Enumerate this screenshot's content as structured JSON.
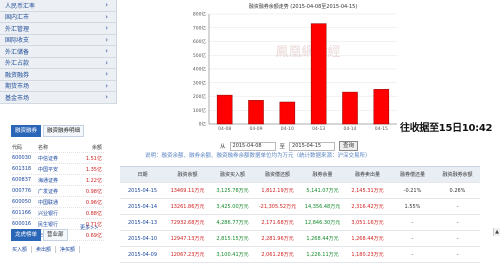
{
  "sidebar": {
    "items": [
      {
        "label": "人民币汇率",
        "icon": "chevron-right-icon"
      },
      {
        "label": "国内汇市",
        "icon": "chevron-right-icon"
      },
      {
        "label": "外汇管理",
        "icon": "chevron-right-icon"
      },
      {
        "label": "国际收支",
        "icon": "chevron-right-icon"
      },
      {
        "label": "外汇储备",
        "icon": "chevron-right-icon"
      },
      {
        "label": "外汇占款",
        "icon": "chevron-right-icon"
      },
      {
        "label": "融资融券",
        "icon": "chevron-right-icon"
      },
      {
        "label": "期货市场",
        "icon": "chevron-right-icon"
      },
      {
        "label": "基金市场",
        "icon": "chevron-right-icon"
      }
    ]
  },
  "rank_tabs": [
    {
      "label": "融资融券",
      "active": true
    },
    {
      "label": "融资融券明细",
      "active": false
    }
  ],
  "rank_list": {
    "header": [
      "代码",
      "名称",
      "余额"
    ],
    "rows": [
      [
        "600030",
        "中信证券",
        "1.51亿"
      ],
      [
        "601318",
        "中国平安",
        "1.35亿"
      ],
      [
        "600837",
        "海通证券",
        "1.22亿"
      ],
      [
        "000776",
        "广发证券",
        "0.98亿"
      ],
      [
        "600050",
        "中国联通",
        "0.96亿"
      ],
      [
        "601166",
        "兴业银行",
        "0.88亿"
      ],
      [
        "600016",
        "民生银行",
        "0.71亿"
      ],
      [
        "601688",
        "华泰证券",
        "0.69亿"
      ]
    ],
    "more": "更多>>"
  },
  "bottom_tabs": [
    {
      "label": "龙虎榜单",
      "active": true
    },
    {
      "label": "营业部",
      "active": false
    }
  ],
  "bottom_subtabs": [
    "买入额",
    "卖出额",
    "净买额"
  ],
  "chart_data": {
    "type": "bar",
    "title": "融资融券余额走势 (2015-04-08至2015-04-15)",
    "categories": [
      "04-08",
      "04-09",
      "04-10",
      "04-13",
      "04-14",
      "04-15"
    ],
    "values": [
      210,
      172,
      160,
      730,
      232,
      252
    ],
    "ylim": [
      0,
      800
    ],
    "yticks": [
      0,
      100,
      200,
      300,
      400,
      500,
      600,
      700,
      800
    ],
    "ytick_unit": "亿",
    "watermark": "鳳凰網財經",
    "color": "#ff0000",
    "grid": true
  },
  "overlay_text": "往收据至15日10:42",
  "date_filter": {
    "from_label": "从",
    "from_value": "2015-04-08",
    "to_label": "至",
    "to_value": "2015-04-15",
    "query_label": "查询"
  },
  "info_line": "说明：融资余额、融券余额、融资融券余额数据单位均为万元（统计数据来源：沪深交易所）",
  "table": {
    "headers": [
      "日期",
      "融资余额",
      "融资买入额",
      "融资偿还额",
      "融券余量",
      "融券卖出量",
      "融券偿还量",
      "融资融券余额"
    ],
    "rows": [
      [
        "2015-04-15",
        "13469.11万元",
        "3,125.78万元",
        "1,812.19万元",
        "5,141.07万元",
        "2,145.31万元",
        "-0.21%",
        "0.26%"
      ],
      [
        "2015-04-14",
        "13261.86万元",
        "3,425.00万元",
        "-21,305.52万元",
        "14,356.48万元",
        "2,316.42万元",
        "1.55%",
        "-"
      ],
      [
        "2015-04-13",
        "72932.68万元",
        "4,286.77万元",
        "2,171.68万元",
        "12,846.30万元",
        "3,051.16万元",
        "-",
        "-"
      ],
      [
        "2015-04-10",
        "12947.13万元",
        "2,815.15万元",
        "2,281.96万元",
        "1,268.44万元",
        "1,268.44万元",
        "-",
        "-"
      ],
      [
        "2015-04-09",
        "12067.23万元",
        "3,100.41万元",
        "2,061.28万元",
        "1,226.11万元",
        "1,180.23万元",
        "-",
        "-"
      ]
    ]
  }
}
